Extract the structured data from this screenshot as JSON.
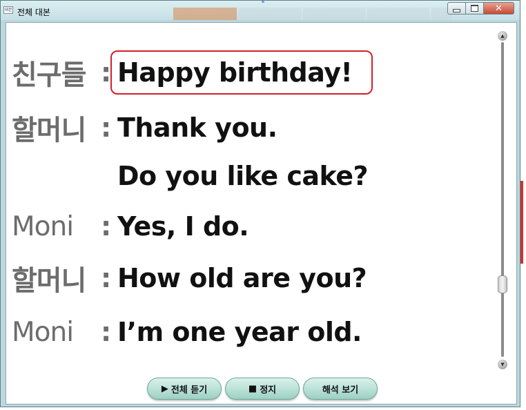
{
  "window": {
    "title": "전체 대본",
    "app_icon_text": "대본"
  },
  "script_lines": [
    {
      "speaker": "친구들",
      "text": "Happy birthday!"
    },
    {
      "speaker": "할머니",
      "text": "Thank you."
    },
    {
      "speaker": "",
      "text": "Do you like cake?"
    },
    {
      "speaker": "Moni",
      "text": "Yes, I do."
    },
    {
      "speaker": "할머니",
      "text": "How old are you?"
    },
    {
      "speaker": "Moni",
      "text": "I’m one year old."
    }
  ],
  "colon": ":",
  "controls": {
    "play_all": {
      "icon": "play-icon",
      "label": "전체 듣기"
    },
    "stop": {
      "icon": "stop-icon",
      "label": "정지"
    },
    "translation": {
      "label": "해석 보기"
    }
  },
  "colors": {
    "highlight": "#d21f26",
    "speaker": "#6c6c6c",
    "speech": "#111111",
    "button": "#bfe4da"
  }
}
